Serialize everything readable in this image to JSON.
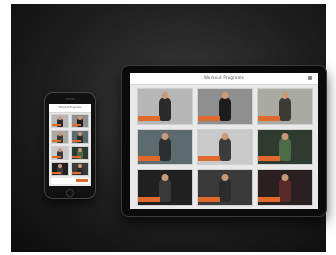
{
  "tablet": {
    "title": "Workout Programs",
    "menu_icon": "menu-icon",
    "tiles": [
      {
        "bg": "#b7b7b7",
        "fig": "#2a2a2a"
      },
      {
        "bg": "#8f8f8f",
        "fig": "#1c1c1c"
      },
      {
        "bg": "#a9aaa2",
        "fig": "#3c3a35"
      },
      {
        "bg": "#5e6b6e",
        "fig": "#2a2f30"
      },
      {
        "bg": "#c9c9c9",
        "fig": "#3b3b3b"
      },
      {
        "bg": "#2f3b30",
        "fig": "#4d6a46"
      },
      {
        "bg": "#202020",
        "fig": "#3a3a3a"
      },
      {
        "bg": "#3a3a3a",
        "fig": "#2b2b2b"
      },
      {
        "bg": "#2b2020",
        "fig": "#5a2a2a"
      }
    ],
    "accent": "#e06a2c"
  },
  "phone": {
    "title": "Workout Programs",
    "tiles": [
      {
        "bg": "#b7b7b7",
        "fig": "#2a2a2a"
      },
      {
        "bg": "#8f8f8f",
        "fig": "#1c1c1c"
      },
      {
        "bg": "#a9aaa2",
        "fig": "#3c3a35"
      },
      {
        "bg": "#5e6b6e",
        "fig": "#2a2f30"
      },
      {
        "bg": "#c9c9c9",
        "fig": "#3b3b3b"
      },
      {
        "bg": "#2f3b30",
        "fig": "#4d6a46"
      },
      {
        "bg": "#202020",
        "fig": "#3a3a3a"
      },
      {
        "bg": "#3a3a3a",
        "fig": "#2b2b2b"
      }
    ],
    "accent": "#e06a2c"
  }
}
